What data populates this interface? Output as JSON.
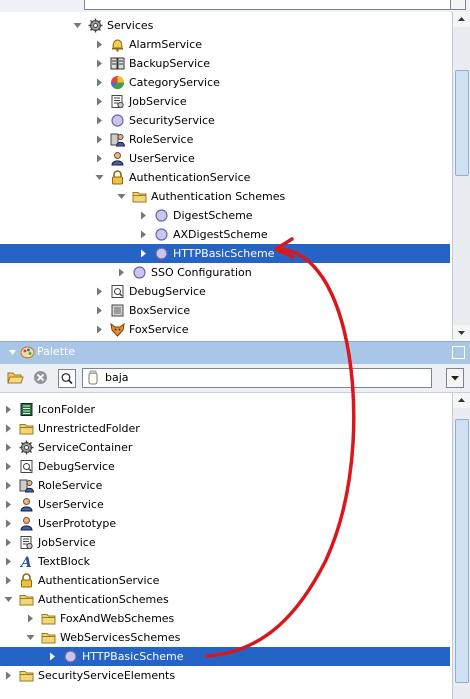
{
  "nav": {
    "rows": [
      {
        "label": "Services",
        "icon": "gear-icon",
        "depth": 0,
        "exp": "open"
      },
      {
        "label": "AlarmService",
        "icon": "bell-icon",
        "depth": 1,
        "exp": "closed"
      },
      {
        "label": "BackupService",
        "icon": "backup-icon",
        "depth": 1,
        "exp": "closed"
      },
      {
        "label": "CategoryService",
        "icon": "category-icon",
        "depth": 1,
        "exp": "closed"
      },
      {
        "label": "JobService",
        "icon": "job-icon",
        "depth": 1,
        "exp": "closed"
      },
      {
        "label": "SecurityService",
        "icon": "circle-icon",
        "depth": 1,
        "exp": "closed"
      },
      {
        "label": "RoleService",
        "icon": "role-icon",
        "depth": 1,
        "exp": "closed"
      },
      {
        "label": "UserService",
        "icon": "user-icon",
        "depth": 1,
        "exp": "closed"
      },
      {
        "label": "AuthenticationService",
        "icon": "lock-icon",
        "depth": 1,
        "exp": "open"
      },
      {
        "label": "Authentication Schemes",
        "icon": "folder-icon",
        "depth": 2,
        "exp": "open"
      },
      {
        "label": "DigestScheme",
        "icon": "circle-icon",
        "depth": 3,
        "exp": "closed"
      },
      {
        "label": "AXDigestScheme",
        "icon": "circle-icon",
        "depth": 3,
        "exp": "closed"
      },
      {
        "label": "HTTPBasicScheme",
        "icon": "circle-icon",
        "depth": 3,
        "exp": "closed",
        "selected": true
      },
      {
        "label": "SSO Configuration",
        "icon": "circle-icon",
        "depth": 2,
        "exp": "closed"
      },
      {
        "label": "DebugService",
        "icon": "debug-icon",
        "depth": 1,
        "exp": "closed"
      },
      {
        "label": "BoxService",
        "icon": "box-icon",
        "depth": 1,
        "exp": "closed"
      },
      {
        "label": "FoxService",
        "icon": "fox-icon",
        "depth": 1,
        "exp": "closed"
      }
    ]
  },
  "palette": {
    "title": "Palette",
    "search_value": "baja",
    "rows": [
      {
        "label": "IconFolder",
        "icon": "icon-folder-icon",
        "depth": 0,
        "exp": "closed"
      },
      {
        "label": "UnrestrictedFolder",
        "icon": "folder-icon",
        "depth": 0,
        "exp": "closed"
      },
      {
        "label": "ServiceContainer",
        "icon": "gear-icon",
        "depth": 0,
        "exp": "closed"
      },
      {
        "label": "DebugService",
        "icon": "debug-icon",
        "depth": 0,
        "exp": "closed"
      },
      {
        "label": "RoleService",
        "icon": "role-icon",
        "depth": 0,
        "exp": "closed"
      },
      {
        "label": "UserService",
        "icon": "user-icon",
        "depth": 0,
        "exp": "closed"
      },
      {
        "label": "UserPrototype",
        "icon": "user-icon",
        "depth": 0,
        "exp": "closed"
      },
      {
        "label": "JobService",
        "icon": "job-icon",
        "depth": 0,
        "exp": "closed"
      },
      {
        "label": "TextBlock",
        "icon": "text-icon",
        "depth": 0,
        "exp": "closed"
      },
      {
        "label": "AuthenticationService",
        "icon": "lock-icon",
        "depth": 0,
        "exp": "closed"
      },
      {
        "label": "AuthenticationSchemes",
        "icon": "folder-icon",
        "depth": 0,
        "exp": "open"
      },
      {
        "label": "FoxAndWebSchemes",
        "icon": "folder-icon",
        "depth": 1,
        "exp": "closed"
      },
      {
        "label": "WebServicesSchemes",
        "icon": "folder-icon",
        "depth": 1,
        "exp": "open"
      },
      {
        "label": "HTTPBasicScheme",
        "icon": "circle-icon",
        "depth": 2,
        "exp": "closed",
        "selected": true
      },
      {
        "label": "SecurityServiceElements",
        "icon": "folder-icon",
        "depth": 0,
        "exp": "closed"
      }
    ]
  },
  "colors": {
    "selection": "#2563c7",
    "palette_header": "#a9c6e6",
    "arrow": "#d9171d"
  }
}
